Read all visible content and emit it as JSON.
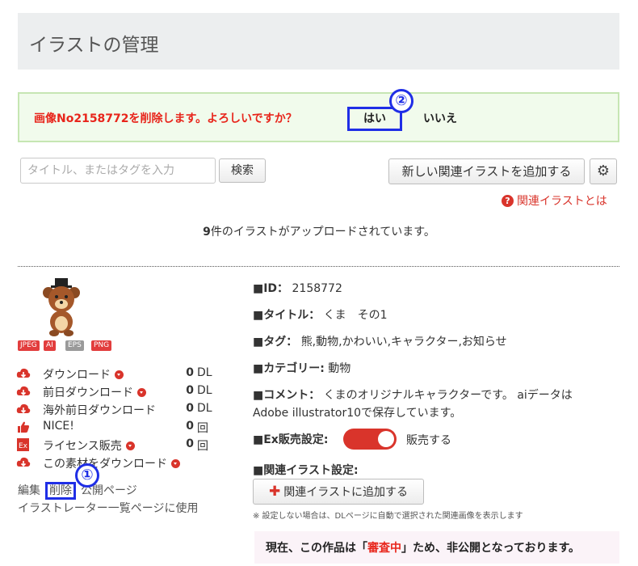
{
  "header": {
    "title": "イラストの管理"
  },
  "confirm": {
    "message": "画像No2158772を削除します。よろしいですか？",
    "yes_label": "はい",
    "no_label": "いいえ",
    "marker2": "②"
  },
  "toolbar": {
    "search_placeholder": "タイトル、またはタグを入力",
    "search_button": "検索",
    "add_related_button": "新しい関連イラストを追加する",
    "help_link": "関連イラストとは",
    "help_icon": "?"
  },
  "count": {
    "num": "9",
    "text": "件のイラストがアップロードされています。"
  },
  "illustration": {
    "formats": [
      "JPEG",
      "AI",
      "EPS",
      "PNG"
    ],
    "stats": [
      {
        "label": "ダウンロード",
        "value": "0",
        "unit": "DL",
        "icon": "cloud-download-icon",
        "dropdown": true
      },
      {
        "label": "前日ダウンロード",
        "value": "0",
        "unit": "DL",
        "icon": "cloud-download-icon",
        "dropdown": true
      },
      {
        "label": "海外前日ダウンロード",
        "value": "0",
        "unit": "DL",
        "icon": "cloud-download-icon",
        "dropdown": false
      },
      {
        "label": "NICE!",
        "value": "0",
        "unit": "回",
        "icon": "thumbs-up-icon",
        "dropdown": false
      },
      {
        "label": "ライセンス販売",
        "value": "0",
        "unit": "回",
        "icon": "ex-icon",
        "dropdown": true
      },
      {
        "label": "この素材をダウンロード",
        "value": "",
        "unit": "",
        "icon": "cloud-download-icon",
        "dropdown": true
      }
    ],
    "actions": {
      "edit": "編集",
      "delete": "削除",
      "public": "公開ページ",
      "use": "イラストレーター一覧ページに使用"
    },
    "marker1": "①",
    "id_label": "■ID：",
    "id_value": "2158772",
    "title_label": "■タイトル：",
    "title_value": "くま　その1",
    "tags_label": "■タグ：",
    "tags_value": "熊,動物,かわいい,キャラクター,お知らせ",
    "category_label": "■カテゴリー:",
    "category_value": "動物",
    "comment_label": "■コメント：",
    "comment_value_1": "くまのオリジナルキャラクターです。 aiデータは",
    "comment_value_2": "Adobe illustrator10で保存しています。",
    "ex_label": "■Ex販売設定:",
    "ex_value": "販売する",
    "related_label": "■関連イラスト設定:",
    "related_button": "関連イラストに追加する",
    "related_note": "※ 設定しない場合は、DLページに自動で選択された関連画像を表示します"
  },
  "notice": {
    "pre": "現在、この作品は「",
    "hl": "審査中",
    "post": "」ため、非公開となっております。"
  },
  "colors": {
    "accent_red": "#d9342b",
    "marker_blue": "#1f2ee6",
    "confirm_bg": "#f1fbec"
  }
}
